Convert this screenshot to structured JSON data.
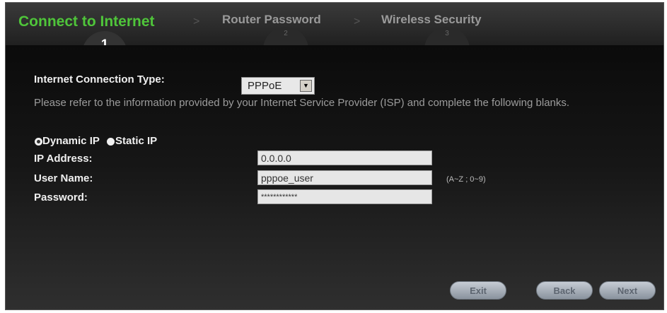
{
  "wizard": {
    "steps": [
      {
        "label": "Connect to Internet",
        "number": "1"
      },
      {
        "label": "Router Password",
        "number": "2"
      },
      {
        "label": "Wireless Security",
        "number": "3"
      }
    ],
    "separator": ">"
  },
  "form": {
    "connection_type_label": "Internet Connection Type:",
    "connection_type_value": "PPPoE",
    "description": "Please refer to the information provided by your Internet Service Provider (ISP) and complete the following blanks.",
    "radio_dynamic_label": "Dynamic IP",
    "radio_static_label": "Static IP",
    "ip_label": "IP Address:",
    "ip_value": "0.0.0.0",
    "username_label": "User Name:",
    "username_value": "pppoe_user",
    "username_hint": "(A~Z ; 0~9)",
    "password_label": "Password:",
    "password_value": "************"
  },
  "buttons": {
    "exit": "Exit",
    "back": "Back",
    "next": "Next"
  },
  "colors": {
    "active_step": "#4fc53a",
    "inactive_step": "#9a9a9a"
  }
}
